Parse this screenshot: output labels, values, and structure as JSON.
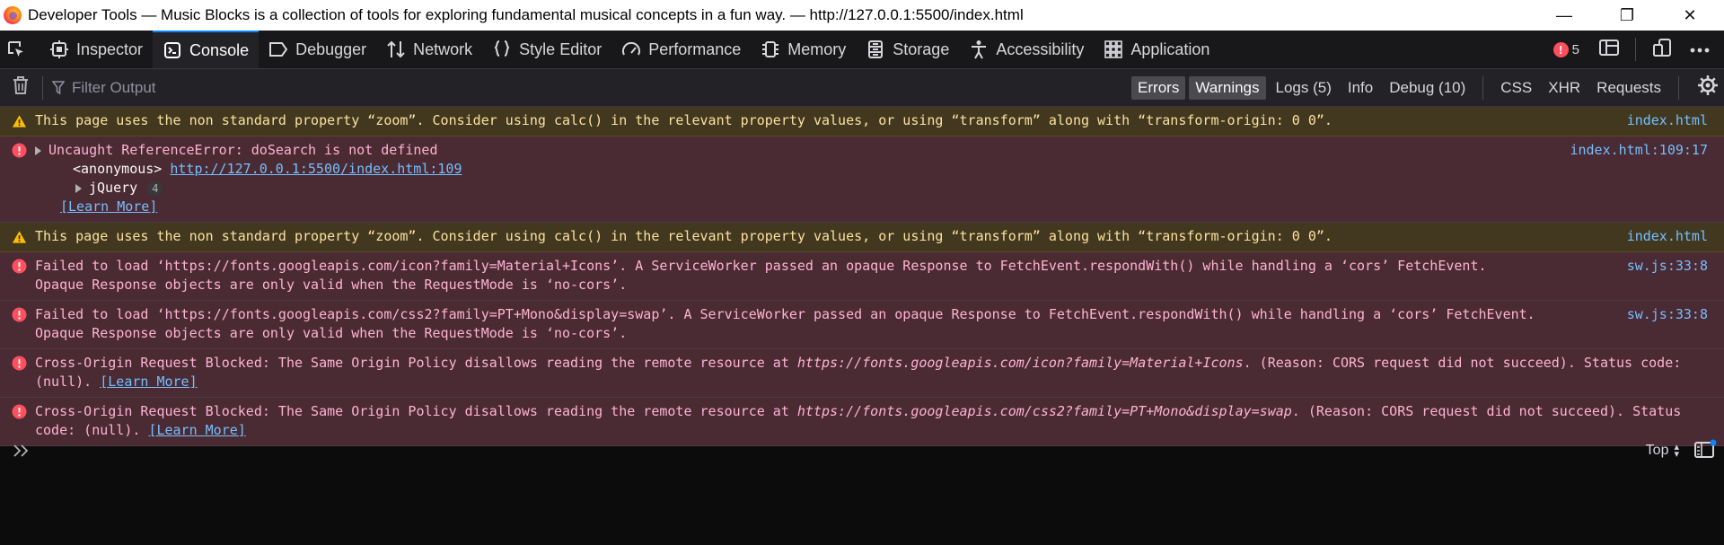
{
  "window": {
    "title": "Developer Tools — Music Blocks is a collection of tools for exploring fundamental musical concepts in a fun way. — http://127.0.0.1:5500/index.html",
    "minimize_glyph": "—",
    "maximize_glyph": "❐",
    "close_glyph": "✕"
  },
  "tabs": [
    {
      "label": "Inspector",
      "icon": "inspector-icon"
    },
    {
      "label": "Console",
      "icon": "console-icon",
      "selected": true
    },
    {
      "label": "Debugger",
      "icon": "debugger-icon"
    },
    {
      "label": "Network",
      "icon": "network-icon"
    },
    {
      "label": "Style Editor",
      "icon": "style-editor-icon"
    },
    {
      "label": "Performance",
      "icon": "performance-icon"
    },
    {
      "label": "Memory",
      "icon": "memory-icon"
    },
    {
      "label": "Storage",
      "icon": "storage-icon"
    },
    {
      "label": "Accessibility",
      "icon": "accessibility-icon"
    },
    {
      "label": "Application",
      "icon": "application-icon"
    }
  ],
  "toolbox_right": {
    "error_count": "5"
  },
  "filterbar": {
    "placeholder": "Filter Output",
    "levels": {
      "errors": "Errors",
      "warnings": "Warnings",
      "logs": "Logs (5)",
      "info": "Info",
      "debug": "Debug (10)"
    },
    "types": {
      "css": "CSS",
      "xhr": "XHR",
      "requests": "Requests"
    }
  },
  "messages": {
    "m1": {
      "text": "This page uses the non standard property “zoom”. Consider using calc() in the relevant property values, or using “transform” along with “transform-origin: 0 0”.",
      "location": "index.html"
    },
    "m2": {
      "text": "Uncaught ReferenceError: doSearch is not defined",
      "location": "index.html:109:17",
      "trace_fn": "<anonymous>",
      "trace_url": "http://127.0.0.1:5500/index.html:109",
      "group_label": "jQuery",
      "group_count": "4",
      "learn_more": "[Learn More]"
    },
    "m3": {
      "text": "This page uses the non standard property “zoom”. Consider using calc() in the relevant property values, or using “transform” along with “transform-origin: 0 0”.",
      "location": "index.html"
    },
    "m4": {
      "text": "Failed to load ‘https://fonts.googleapis.com/icon?family=Material+Icons’. A ServiceWorker passed an opaque Response to FetchEvent.respondWith() while handling a ‘cors’ FetchEvent. Opaque Response objects are only valid when the RequestMode is ‘no-cors’.",
      "location": "sw.js:33:8"
    },
    "m5": {
      "text": "Failed to load ‘https://fonts.googleapis.com/css2?family=PT+Mono&display=swap’. A ServiceWorker passed an opaque Response to FetchEvent.respondWith() while handling a ‘cors’ FetchEvent. Opaque Response objects are only valid when the RequestMode is ‘no-cors’.",
      "location": "sw.js:33:8"
    },
    "m6": {
      "prefix": "Cross-Origin Request Blocked: The Same Origin Policy disallows reading the remote resource at ",
      "url": "https://fonts.googleapis.com/icon?family=Material+Icons",
      "suffix": ". (Reason: CORS request did not succeed). Status code: (null). ",
      "learn_more": "[Learn More]"
    },
    "m7": {
      "prefix": "Cross-Origin Request Blocked: The Same Origin Policy disallows reading the remote resource at ",
      "url": "https://fonts.googleapis.com/css2?family=PT+Mono&display=swap",
      "suffix": ". (Reason: CORS request did not succeed). Status code: (null). ",
      "learn_more": "[Learn More]"
    }
  },
  "input": {
    "context": "Top"
  },
  "colors": {
    "accent": "#0a84ff",
    "error": "#ff4f5e",
    "warning": "#ffbf00",
    "link": "#75bfff"
  }
}
